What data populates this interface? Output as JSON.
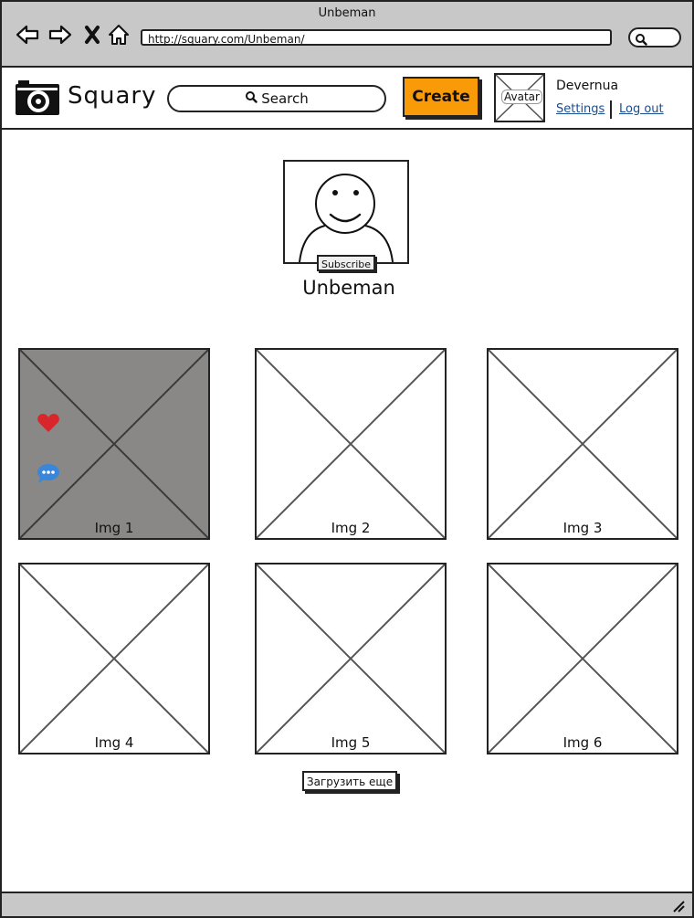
{
  "window": {
    "title": "Unbeman",
    "url": "http://squary.com/Unbeman/"
  },
  "header": {
    "brand": "Squary",
    "search_label": "Search",
    "create_label": "Create",
    "avatar_label": "Avatar",
    "username": "Devernua",
    "settings_link": "Settings",
    "logout_link": "Log out",
    "create_color": "#f99b08"
  },
  "profile": {
    "name": "Unbeman",
    "subscribe_label": "Subscribe"
  },
  "gallery": {
    "images": [
      {
        "label": "Img 1",
        "hovered": true
      },
      {
        "label": "Img 2"
      },
      {
        "label": "Img 3"
      },
      {
        "label": "Img 4"
      },
      {
        "label": "Img 5"
      },
      {
        "label": "Img 6"
      }
    ],
    "load_more_label": "Загрузить еще"
  },
  "icons": [
    "back-icon",
    "forward-icon",
    "close-icon",
    "home-icon",
    "search-icon",
    "camera-logo-icon",
    "heart-icon",
    "comment-icon",
    "resize-grip-icon"
  ]
}
